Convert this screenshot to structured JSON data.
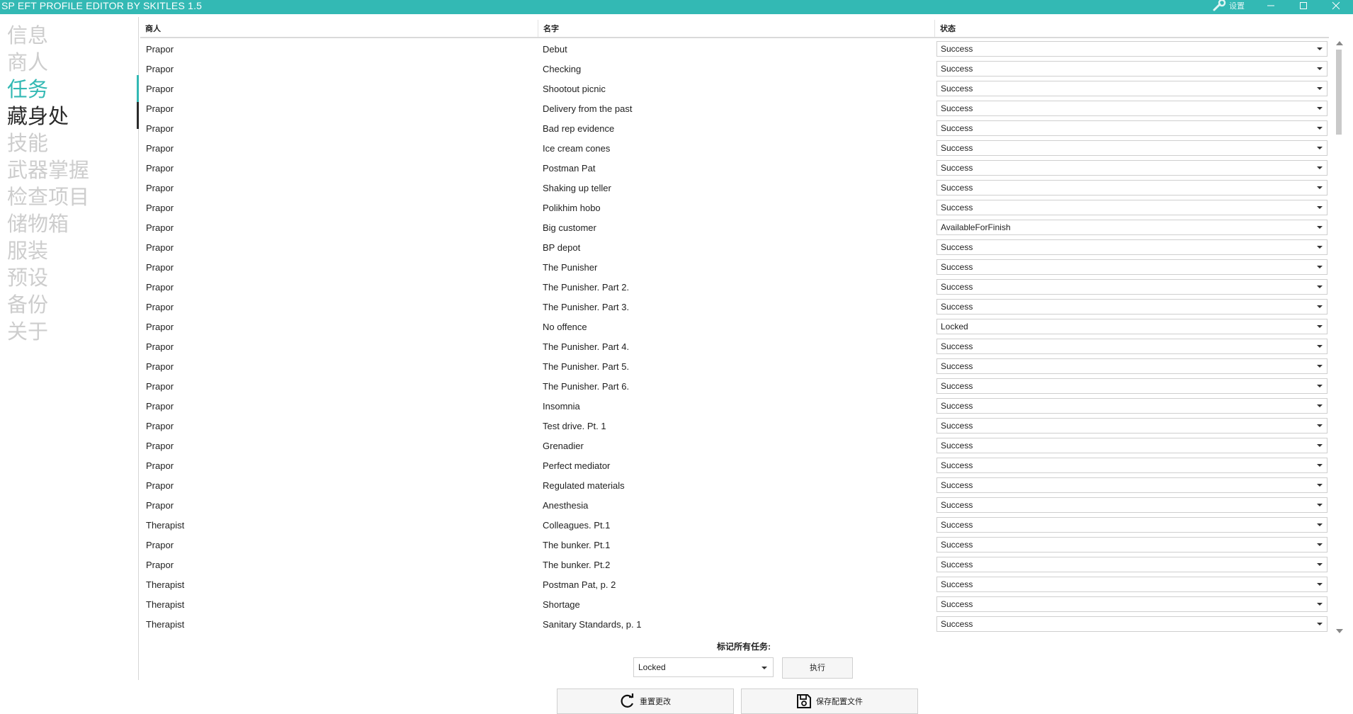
{
  "window": {
    "title": "SP EFT PROFILE EDITOR BY SKITLES 1.5",
    "settings_label": "设置"
  },
  "sidebar": {
    "items": [
      {
        "label": "信息"
      },
      {
        "label": "商人"
      },
      {
        "label": "任务",
        "state": "active"
      },
      {
        "label": "藏身处",
        "state": "hover"
      },
      {
        "label": "技能"
      },
      {
        "label": "武器掌握"
      },
      {
        "label": "检查项目"
      },
      {
        "label": "储物箱"
      },
      {
        "label": "服装"
      },
      {
        "label": "预设"
      },
      {
        "label": "备份"
      },
      {
        "label": "关于"
      }
    ]
  },
  "table": {
    "columns": [
      "商人",
      "名字",
      "状态"
    ],
    "rows": [
      {
        "trader": "Prapor",
        "name": "Debut",
        "status": "Success"
      },
      {
        "trader": "Prapor",
        "name": "Checking",
        "status": "Success"
      },
      {
        "trader": "Prapor",
        "name": "Shootout picnic",
        "status": "Success"
      },
      {
        "trader": "Prapor",
        "name": "Delivery from the past",
        "status": "Success"
      },
      {
        "trader": "Prapor",
        "name": "Bad rep evidence",
        "status": "Success"
      },
      {
        "trader": "Prapor",
        "name": "Ice cream cones",
        "status": "Success"
      },
      {
        "trader": "Prapor",
        "name": "Postman Pat",
        "status": "Success"
      },
      {
        "trader": "Prapor",
        "name": "Shaking up teller",
        "status": "Success"
      },
      {
        "trader": "Prapor",
        "name": "Polikhim hobo",
        "status": "Success"
      },
      {
        "trader": "Prapor",
        "name": "Big customer",
        "status": "AvailableForFinish"
      },
      {
        "trader": "Prapor",
        "name": "BP depot",
        "status": "Success"
      },
      {
        "trader": "Prapor",
        "name": "The Punisher",
        "status": "Success"
      },
      {
        "trader": "Prapor",
        "name": "The Punisher. Part 2.",
        "status": "Success"
      },
      {
        "trader": "Prapor",
        "name": "The Punisher. Part 3.",
        "status": "Success"
      },
      {
        "trader": "Prapor",
        "name": "No offence",
        "status": "Locked"
      },
      {
        "trader": "Prapor",
        "name": "The Punisher. Part 4.",
        "status": "Success"
      },
      {
        "trader": "Prapor",
        "name": "The Punisher. Part 5.",
        "status": "Success"
      },
      {
        "trader": "Prapor",
        "name": "The Punisher. Part 6.",
        "status": "Success"
      },
      {
        "trader": "Prapor",
        "name": "Insomnia",
        "status": "Success"
      },
      {
        "trader": "Prapor",
        "name": "Test drive. Pt. 1",
        "status": "Success"
      },
      {
        "trader": "Prapor",
        "name": "Grenadier",
        "status": "Success"
      },
      {
        "trader": "Prapor",
        "name": "Perfect mediator",
        "status": "Success"
      },
      {
        "trader": "Prapor",
        "name": "Regulated materials",
        "status": "Success"
      },
      {
        "trader": "Prapor",
        "name": "Anesthesia",
        "status": "Success"
      },
      {
        "trader": "Therapist",
        "name": "Colleagues. Pt.1",
        "status": "Success"
      },
      {
        "trader": "Prapor",
        "name": "The bunker. Pt.1",
        "status": "Success"
      },
      {
        "trader": "Prapor",
        "name": "The bunker. Pt.2",
        "status": "Success"
      },
      {
        "trader": "Therapist",
        "name": "Postman Pat, p. 2",
        "status": "Success"
      },
      {
        "trader": "Therapist",
        "name": "Shortage",
        "status": "Success"
      },
      {
        "trader": "Therapist",
        "name": "Sanitary Standards, p. 1",
        "status": "Success"
      }
    ]
  },
  "footer": {
    "mark_all_label": "标记所有任务:",
    "mark_all_value": "Locked",
    "execute_label": "执行",
    "reset_label": "重置更改",
    "save_label": "保存配置文件"
  },
  "colors": {
    "accent": "#33b9b4",
    "sidebar_inactive": "#cdcdcd"
  }
}
